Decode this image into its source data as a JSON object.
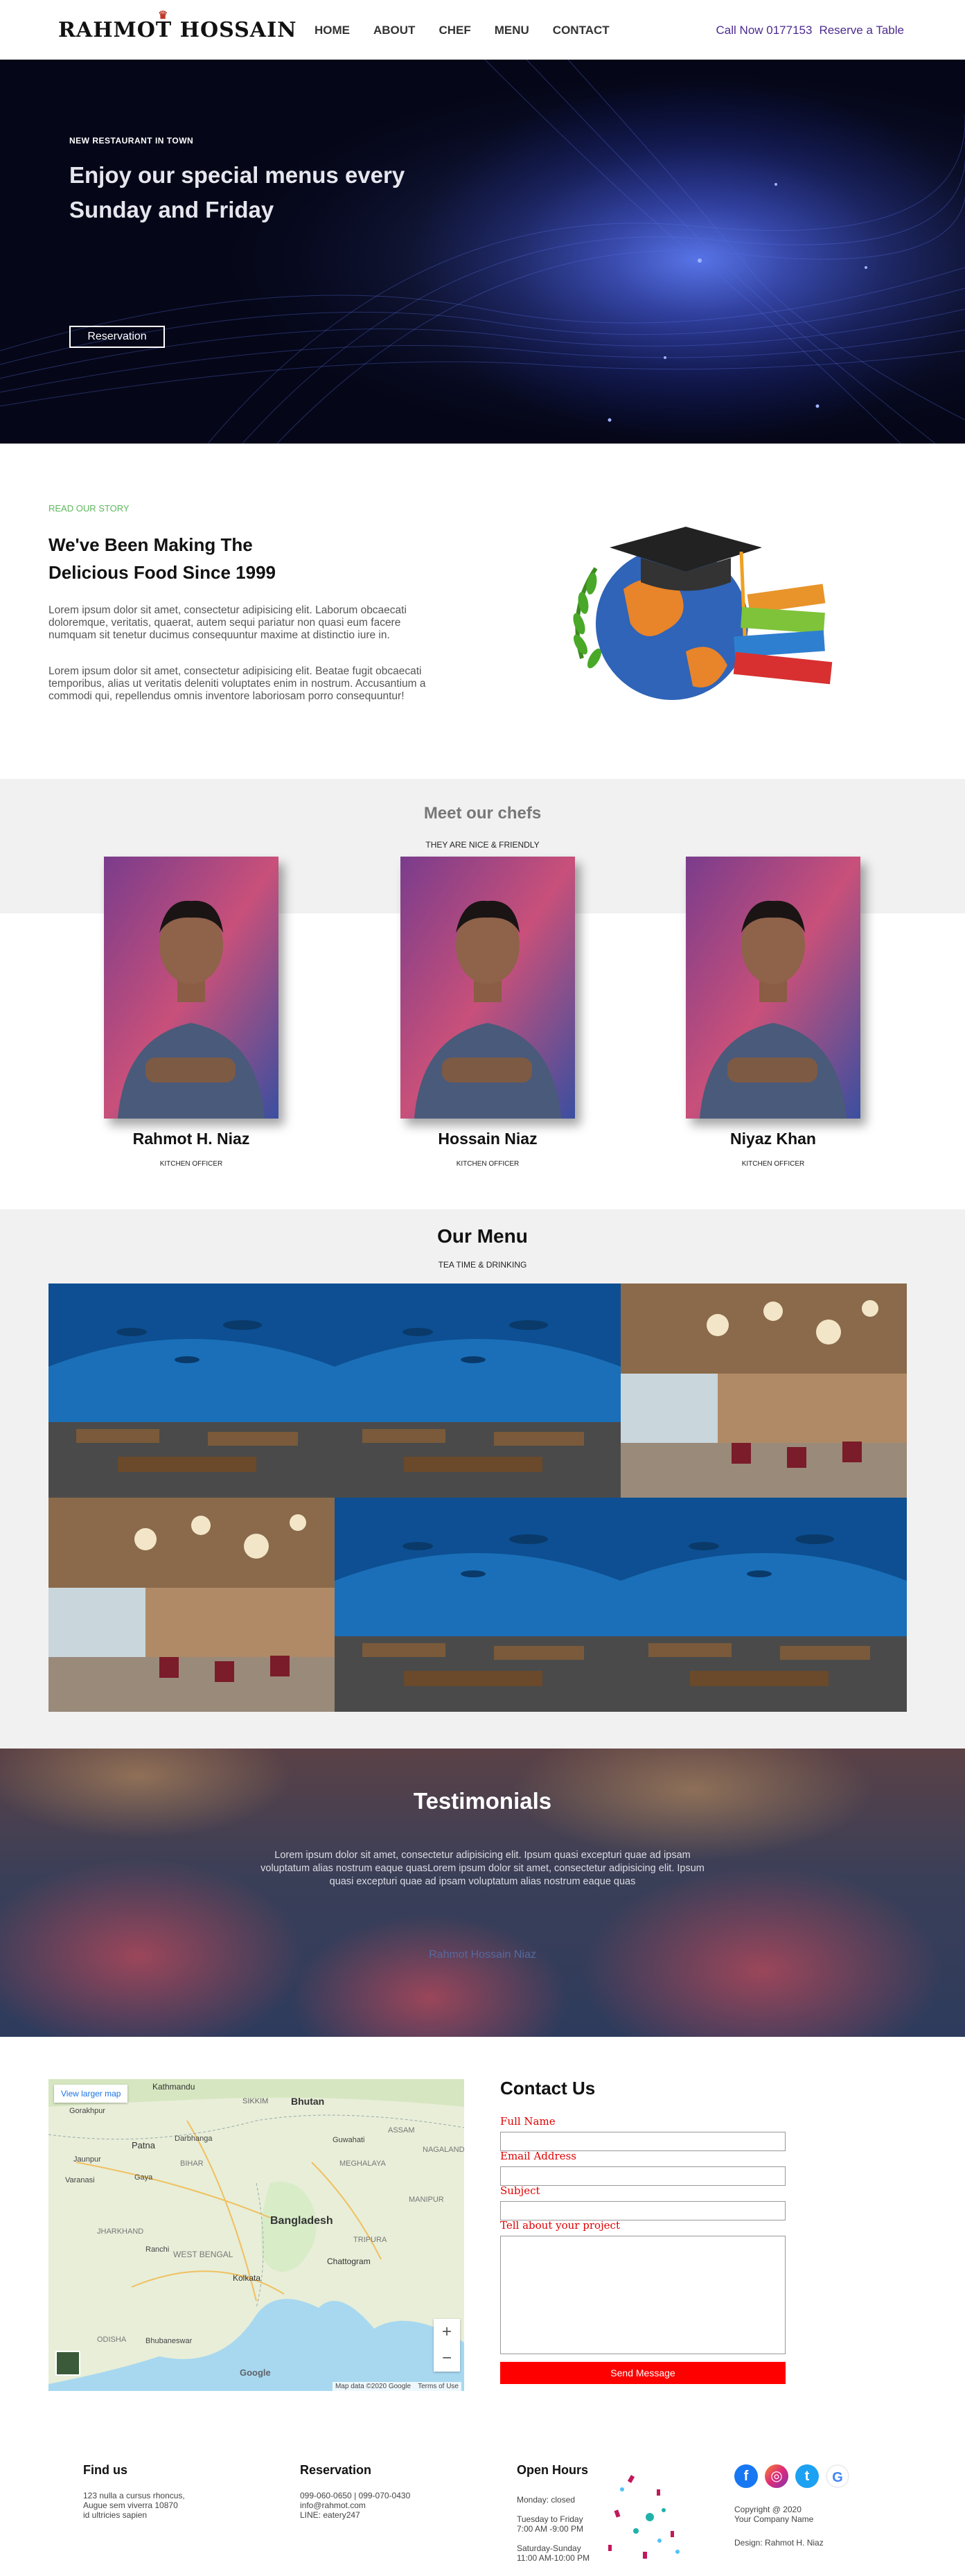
{
  "nav": {
    "logo": "RAHMOT HOSSAIN",
    "items": [
      "HOME",
      "ABOUT",
      "CHEF",
      "MENU",
      "CONTACT"
    ],
    "call": "Call Now 0177153",
    "reserve": "Reserve a Table"
  },
  "hero": {
    "tag": "NEW RESTAURANT IN TOWN",
    "title": "Enjoy our special menus every Sunday and Friday",
    "button": "Reservation"
  },
  "story": {
    "tag": "READ OUR STORY",
    "title": "We've Been Making The Delicious Food Since 1999",
    "p1": "Lorem ipsum dolor sit amet, consectetur adipisicing elit. Laborum obcaecati doloremque, veritatis, quaerat, autem sequi pariatur non quasi eum facere numquam sit tenetur ducimus consequuntur maxime at distinctio iure in.",
    "p2": "Lorem ipsum dolor sit amet, consectetur adipisicing elit. Beatae fugit obcaecati temporibus, alias ut veritatis deleniti voluptates enim in nostrum. Accusantium a commodi qui, repellendus omnis inventore laboriosam porro consequuntur!"
  },
  "chefs": {
    "title": "Meet our chefs",
    "subtitle": "THEY ARE NICE & FRIENDLY",
    "list": [
      {
        "name": "Rahmot H. Niaz",
        "role": "KITCHEN OFFICER"
      },
      {
        "name": "Hossain Niaz",
        "role": "KITCHEN OFFICER"
      },
      {
        "name": "Niyaz Khan",
        "role": "KITCHEN OFFICER"
      }
    ]
  },
  "menu": {
    "title": "Our Menu",
    "subtitle": "TEA TIME & DRINKING"
  },
  "testimonials": {
    "title": "Testimonials",
    "text": "Lorem ipsum dolor sit amet, consectetur adipisicing elit. Ipsum quasi excepturi quae ad ipsam voluptatum alias nostrum eaque quasLorem ipsum dolor sit amet, consectetur adipisicing elit. Ipsum quasi excepturi quae ad ipsam voluptatum alias nostrum eaque quas",
    "author": "Rahmot Hossain Niaz"
  },
  "map": {
    "larger": "View larger map",
    "labels": [
      "Kathmandu",
      "Bhutan",
      "SIKKIM",
      "Gorakhpur",
      "Patna",
      "Darbhanga",
      "Guwahati",
      "ASSAM",
      "NAGALAND",
      "MEGHALAYA",
      "Jaunpur",
      "Varanasi",
      "BIHAR",
      "Gaya",
      "MANIPUR",
      "JHARKHAND",
      "Bangladesh",
      "WEST BENGAL",
      "Ranchi",
      "Kolkata",
      "Chattogram",
      "TRIPURA",
      "ODISHA",
      "Bhubaneswar"
    ],
    "attribution": "Map data ©2020 Google",
    "terms": "Terms of Use",
    "google": "Google"
  },
  "contact": {
    "title": "Contact Us",
    "full_name": "Full Name",
    "email": "Email Address",
    "subject": "Subject",
    "project": "Tell about your project",
    "send": "Send Message"
  },
  "footer": {
    "find_title": "Find us",
    "find_lines": [
      "123 nulla a cursus rhoncus,",
      "Augue sem viverra 10870",
      "id ultricies sapien"
    ],
    "res_title": "Reservation",
    "res_lines": [
      "099-060-0650 | 099-070-0430",
      "info@rahmot.com",
      "LINE: eatery247"
    ],
    "hours_title": "Open Hours",
    "hours_lines": [
      "Monday: closed",
      "",
      "Tuesday to Friday",
      "7:00 AM -9:00 PM",
      "",
      "Saturday-Sunday",
      "11:00 AM-10:00 PM"
    ],
    "copyright_lines": [
      "Copyright @ 2020",
      "Your Company Name"
    ],
    "design": "Design: Rahmot H. Niaz"
  },
  "colors": {
    "accent_green": "#5cb85c",
    "nav_purple": "#4b2a8f",
    "send_red": "#ff0000"
  }
}
